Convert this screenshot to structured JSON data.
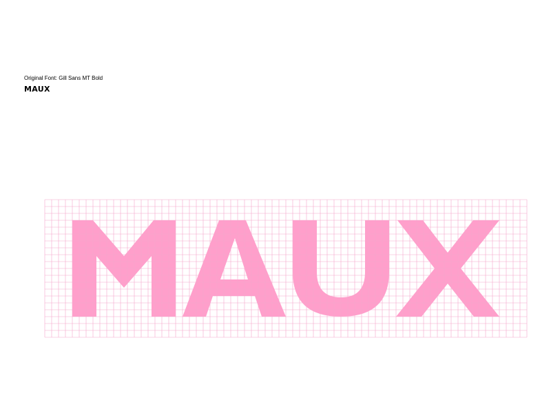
{
  "caption": "Original Font: Gill Sans MT Bold",
  "sample_text": "MAUX",
  "specimen_letters": [
    "M",
    "A",
    "U",
    "X"
  ],
  "colors": {
    "glyph_fill": "#ff9fcb",
    "grid_line": "#f3a7cc",
    "background": "#ffffff",
    "text": "#000000"
  }
}
